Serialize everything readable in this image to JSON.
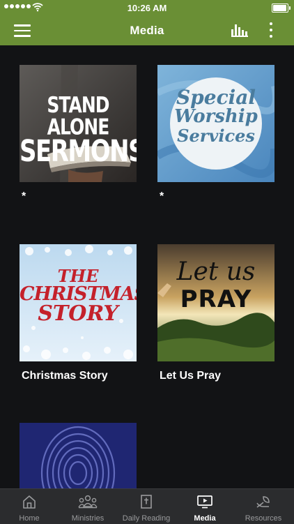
{
  "status": {
    "time": "10:26 AM",
    "icons": [
      "signal-dots",
      "wifi-icon",
      "battery-icon"
    ]
  },
  "header": {
    "title": "Media",
    "icons": [
      "menu-icon",
      "equalizer-icon",
      "more-vertical-icon"
    ]
  },
  "media_items": [
    {
      "title": "*",
      "art_text": [
        "STAND ALONE",
        "SERMONS"
      ]
    },
    {
      "title": "*",
      "art_text": [
        "Special",
        "Worship",
        "Services"
      ]
    },
    {
      "title": "Christmas Story",
      "art_text": [
        "THE",
        "CHRISTMAS",
        "STORY"
      ]
    },
    {
      "title": "Let Us Pray",
      "art_text": [
        "Let us",
        "PRAY"
      ]
    },
    {
      "title": "",
      "art_text": []
    }
  ],
  "tabs": [
    {
      "label": "Home",
      "icon": "home-icon",
      "active": false
    },
    {
      "label": "Ministries",
      "icon": "people-icon",
      "active": false
    },
    {
      "label": "Daily Reading",
      "icon": "bible-icon",
      "active": false
    },
    {
      "label": "Media",
      "icon": "media-play-icon",
      "active": true
    },
    {
      "label": "Resources",
      "icon": "leaf-hand-icon",
      "active": false
    }
  ],
  "colors": {
    "brand_green": "#6a8f35",
    "background": "#121315",
    "tabbar": "#2b2c2e",
    "tab_inactive": "#9a9b9d"
  }
}
